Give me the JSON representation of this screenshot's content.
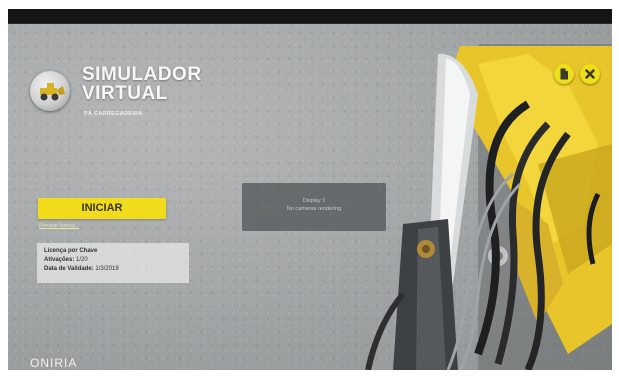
{
  "window": {
    "title": "",
    "tab": "",
    "status": ""
  },
  "app": {
    "title_line1": "SIMULADOR",
    "title_line2": "VIRTUAL",
    "subtitle": "PÁ CARREGADEIRA",
    "brand": "ONIRIA"
  },
  "actions": {
    "start_label": "INICIAR",
    "license_link": "Renovar licença..."
  },
  "license": {
    "type_label": "Licença por Chave",
    "activations_label": "Ativações:",
    "activations_value": "1/20",
    "validity_label": "Data de Validade:",
    "validity_value": "1/3/2019"
  },
  "display_panel": {
    "line1": "Display 1",
    "line2": "No cameras rendering"
  },
  "icons": {
    "manual": "document-icon",
    "close": "close-icon"
  },
  "colors": {
    "accent": "#f0dc1a",
    "background": "#a7aaab"
  }
}
